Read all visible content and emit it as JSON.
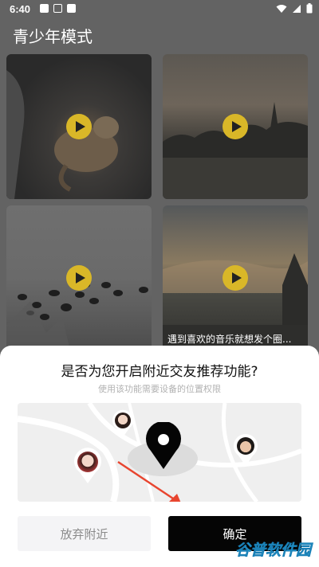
{
  "status_bar": {
    "time": "6:40",
    "left_icons": [
      "notification-icon",
      "app-icon-a",
      "app-icon-square"
    ],
    "right_icons": [
      "wifi-icon",
      "signal-icon",
      "battery-icon"
    ]
  },
  "page": {
    "title": "青少年模式"
  },
  "videos": [
    {
      "thumbnail": "cat at night",
      "play_icon": "play-icon",
      "caption": ""
    },
    {
      "thumbnail": "sunset trees",
      "play_icon": "play-icon",
      "caption": ""
    },
    {
      "thumbnail": "elephant herd",
      "play_icon": "play-icon",
      "caption": ""
    },
    {
      "thumbnail": "cloudy sky",
      "play_icon": "play-icon",
      "caption": "遇到喜欢的音乐就想发个圈..."
    }
  ],
  "dialog": {
    "title": "是否为您开启附近交友推荐功能?",
    "subtitle": "使用该功能需要设备的位置权限",
    "cancel_label": "放弃附近",
    "confirm_label": "确定"
  },
  "watermark": "谷普软件园",
  "colors": {
    "accent_play": "#d9b728",
    "confirm_bg": "#050505",
    "cancel_bg": "#f4f4f6",
    "annotation_arrow": "#e8452f"
  }
}
